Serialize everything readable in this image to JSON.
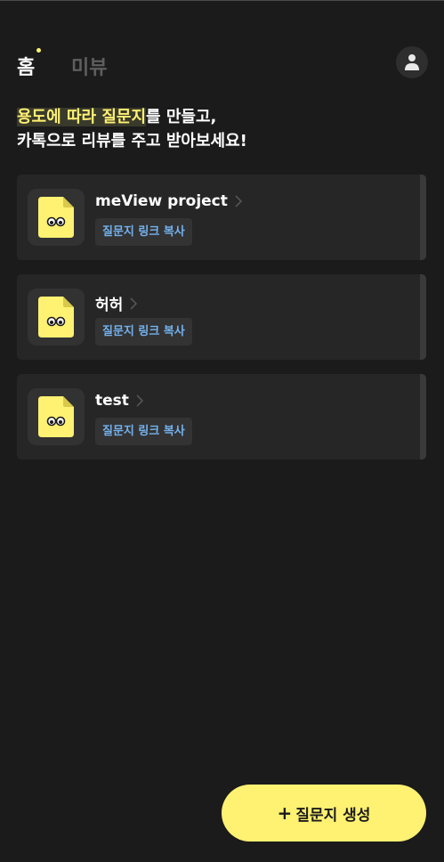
{
  "header": {
    "tabs": [
      {
        "label": "홈",
        "active": true
      },
      {
        "label": "미뷰",
        "active": false
      }
    ],
    "avatar_icon": "user-icon"
  },
  "headline": {
    "highlight": "용도에 따라 질문지",
    "line1_rest": "를 만들고,",
    "line2": "카톡으로 리뷰를 주고 받아보세요!"
  },
  "questionnaires": [
    {
      "title": "meView project",
      "copy_label": "질문지 링크 복사"
    },
    {
      "title": "허허",
      "copy_label": "질문지 링크 복사"
    },
    {
      "title": "test",
      "copy_label": "질문지 링크 복사"
    }
  ],
  "fab": {
    "icon": "+",
    "label": "질문지 생성"
  },
  "colors": {
    "background": "#1b1b1b",
    "card": "#262626",
    "accent": "#fff172",
    "link": "#74b2ee"
  }
}
